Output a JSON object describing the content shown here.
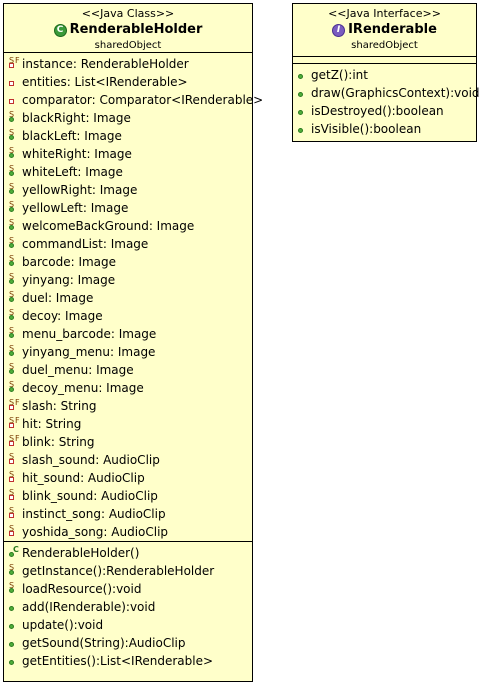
{
  "renderable_holder": {
    "stereotype": "<<Java Class>>",
    "name": "RenderableHolder",
    "package": "sharedObject",
    "badge_letter": "C",
    "attributes": [
      {
        "text": "instance: RenderableHolder",
        "vis": "private",
        "mods": [
          "S",
          "F"
        ]
      },
      {
        "text": "entities: List<IRenderable>",
        "vis": "private",
        "mods": []
      },
      {
        "text": "comparator: Comparator<IRenderable>",
        "vis": "private",
        "mods": []
      },
      {
        "text": "blackRight: Image",
        "vis": "public",
        "mods": [
          "S"
        ]
      },
      {
        "text": "blackLeft: Image",
        "vis": "public",
        "mods": [
          "S"
        ]
      },
      {
        "text": "whiteRight: Image",
        "vis": "public",
        "mods": [
          "S"
        ]
      },
      {
        "text": "whiteLeft: Image",
        "vis": "public",
        "mods": [
          "S"
        ]
      },
      {
        "text": "yellowRight: Image",
        "vis": "public",
        "mods": [
          "S"
        ]
      },
      {
        "text": "yellowLeft: Image",
        "vis": "public",
        "mods": [
          "S"
        ]
      },
      {
        "text": "welcomeBackGround: Image",
        "vis": "public",
        "mods": [
          "S"
        ]
      },
      {
        "text": "commandList: Image",
        "vis": "public",
        "mods": [
          "S"
        ]
      },
      {
        "text": "barcode: Image",
        "vis": "public",
        "mods": [
          "S"
        ]
      },
      {
        "text": "yinyang: Image",
        "vis": "public",
        "mods": [
          "S"
        ]
      },
      {
        "text": "duel: Image",
        "vis": "public",
        "mods": [
          "S"
        ]
      },
      {
        "text": "decoy: Image",
        "vis": "public",
        "mods": [
          "S"
        ]
      },
      {
        "text": "menu_barcode: Image",
        "vis": "public",
        "mods": [
          "S"
        ]
      },
      {
        "text": "yinyang_menu: Image",
        "vis": "public",
        "mods": [
          "S"
        ]
      },
      {
        "text": "duel_menu: Image",
        "vis": "public",
        "mods": [
          "S"
        ]
      },
      {
        "text": "decoy_menu: Image",
        "vis": "public",
        "mods": [
          "S"
        ]
      },
      {
        "text": "slash: String",
        "vis": "private",
        "mods": [
          "S",
          "F"
        ]
      },
      {
        "text": "hit: String",
        "vis": "private",
        "mods": [
          "S",
          "F"
        ]
      },
      {
        "text": "blink: String",
        "vis": "private",
        "mods": [
          "S",
          "F"
        ]
      },
      {
        "text": "slash_sound: AudioClip",
        "vis": "private",
        "mods": [
          "S"
        ]
      },
      {
        "text": "hit_sound: AudioClip",
        "vis": "private",
        "mods": [
          "S"
        ]
      },
      {
        "text": "blink_sound: AudioClip",
        "vis": "private",
        "mods": [
          "S"
        ]
      },
      {
        "text": "instinct_song: AudioClip",
        "vis": "private",
        "mods": [
          "S"
        ]
      },
      {
        "text": "yoshida_song: AudioClip",
        "vis": "private",
        "mods": [
          "S"
        ]
      }
    ],
    "operations": [
      {
        "text": "RenderableHolder()",
        "vis": "public",
        "mods": [
          "C"
        ]
      },
      {
        "text": "getInstance():RenderableHolder",
        "vis": "public",
        "mods": [
          "S"
        ]
      },
      {
        "text": "loadResource():void",
        "vis": "public",
        "mods": [
          "S"
        ]
      },
      {
        "text": "add(IRenderable):void",
        "vis": "public",
        "mods": []
      },
      {
        "text": "update():void",
        "vis": "public",
        "mods": []
      },
      {
        "text": "getSound(String):AudioClip",
        "vis": "public",
        "mods": []
      },
      {
        "text": "getEntities():List<IRenderable>",
        "vis": "public",
        "mods": []
      }
    ]
  },
  "irenderable": {
    "stereotype": "<<Java Interface>>",
    "name": "IRenderable",
    "package": "sharedObject",
    "badge_letter": "I",
    "operations": [
      {
        "text": "getZ():int",
        "vis": "public",
        "mods": []
      },
      {
        "text": "draw(GraphicsContext):void",
        "vis": "public",
        "mods": []
      },
      {
        "text": "isDestroyed():boolean",
        "vis": "public",
        "mods": []
      },
      {
        "text": "isVisible():boolean",
        "vis": "public",
        "mods": []
      }
    ]
  },
  "colors": {
    "box_fill": "#ffffca",
    "border": "#000000",
    "class_badge": "#3a9a3a",
    "interface_badge": "#7a5cc0",
    "public_marker": "#4fae3a",
    "private_marker": "#c03030"
  }
}
